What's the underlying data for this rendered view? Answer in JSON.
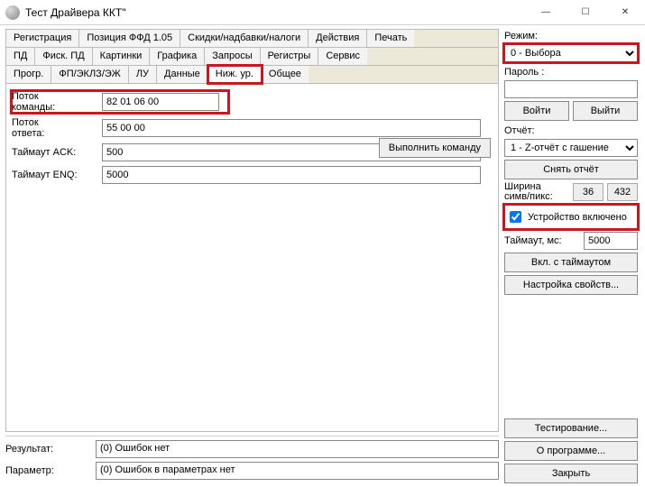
{
  "window": {
    "title": "Тест Драйвера ККТ\""
  },
  "tabs": {
    "row1": [
      "Регистрация",
      "Позиция ФФД 1.05",
      "Скидки/надбавки/налоги",
      "Действия",
      "Печать"
    ],
    "row2": [
      "ПД",
      "Фиск. ПД",
      "Картинки",
      "Графика",
      "Запросы",
      "Регистры",
      "Сервис"
    ],
    "row3": [
      "Прогр.",
      "ФП/ЭКЛЗ/ЭЖ",
      "ЛУ",
      "Данные",
      "Ниж. ур.",
      "Общее"
    ],
    "active": "Ниж. ур."
  },
  "form": {
    "cmd_stream_label": "Поток\nкоманды:",
    "cmd_stream_value": "82 01 06 00",
    "ans_stream_label": "Поток\nответа:",
    "ans_stream_value": "55 00 00",
    "timeout_ack_label": "Таймаут ACK:",
    "timeout_ack_value": "500",
    "timeout_enq_label": "Таймаут ENQ:",
    "timeout_enq_value": "5000",
    "execute_btn": "Выполнить команду"
  },
  "status": {
    "result_label": "Результат:",
    "result_value": "(0) Ошибок нет",
    "param_label": "Параметр:",
    "param_value": "(0) Ошибок в параметрах нет"
  },
  "side": {
    "mode_label": "Режим:",
    "mode_value": "0 - Выбора",
    "password_label": "Пароль :",
    "password_value": "",
    "login_btn": "Войти",
    "logout_btn": "Выйти",
    "report_label": "Отчёт:",
    "report_value": "1 - Z-отчёт с гашение",
    "take_report_btn": "Снять отчёт",
    "width_label": "Ширина\nсимв/пикс:",
    "width_chars": "36",
    "width_px": "432",
    "device_on_label": "Устройство включено",
    "device_on_checked": true,
    "timeout_label": "Таймаут, мс:",
    "timeout_value": "5000",
    "timeout_on_btn": "Вкл. с таймаутом",
    "props_btn": "Настройка свойств...",
    "testing_btn": "Тестирование...",
    "about_btn": "О программе...",
    "close_btn": "Закрыть"
  }
}
